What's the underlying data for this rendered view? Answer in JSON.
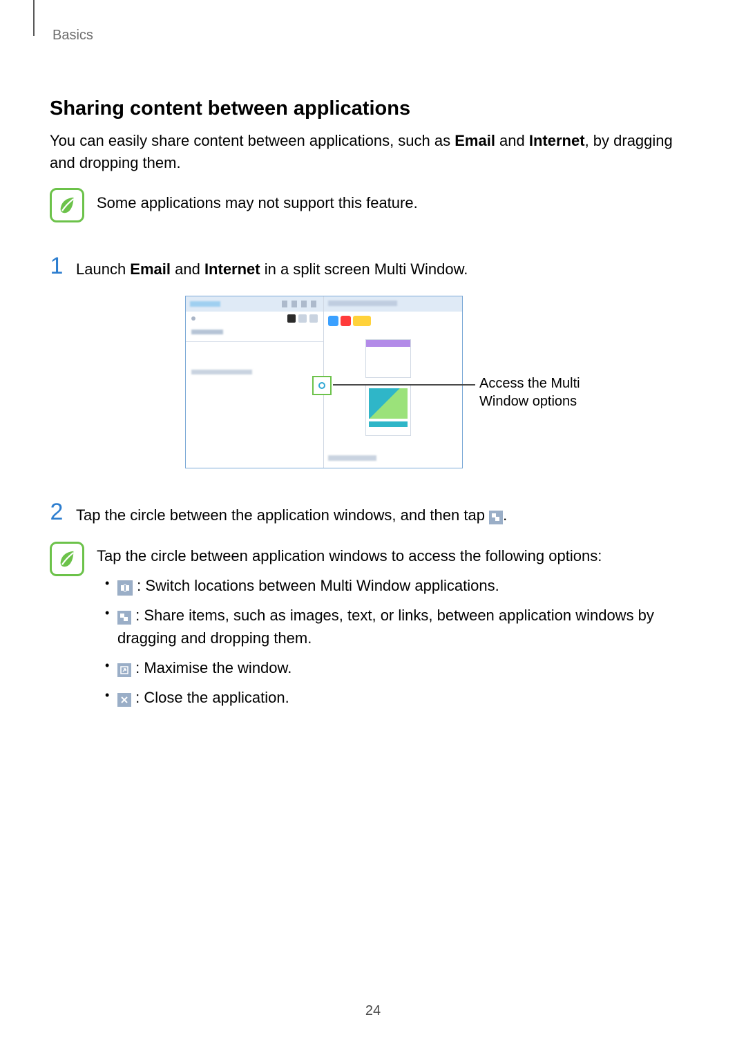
{
  "breadcrumb": "Basics",
  "section_title": "Sharing content between applications",
  "lead": {
    "pre": "You can easily share content between applications, such as ",
    "bold1": "Email",
    "mid": " and ",
    "bold2": "Internet",
    "post": ", by dragging and dropping them."
  },
  "note1": "Some applications may not support this feature.",
  "steps": {
    "s1": {
      "num": "1",
      "pre": "Launch ",
      "bold1": "Email",
      "mid": " and ",
      "bold2": "Internet",
      "post": " in a split screen Multi Window."
    },
    "s2": {
      "num": "2",
      "pre": "Tap the circle between the application windows, and then tap ",
      "post": "."
    }
  },
  "callout": "Access the Multi Window options",
  "info": {
    "intro": "Tap the circle between application windows to access the following options:",
    "opt_switch": " : Switch locations between Multi Window applications.",
    "opt_share": " : Share items, such as images, text, or links, between application windows by dragging and dropping them.",
    "opt_max": " : Maximise the window.",
    "opt_close": " : Close the application."
  },
  "page_number": "24"
}
